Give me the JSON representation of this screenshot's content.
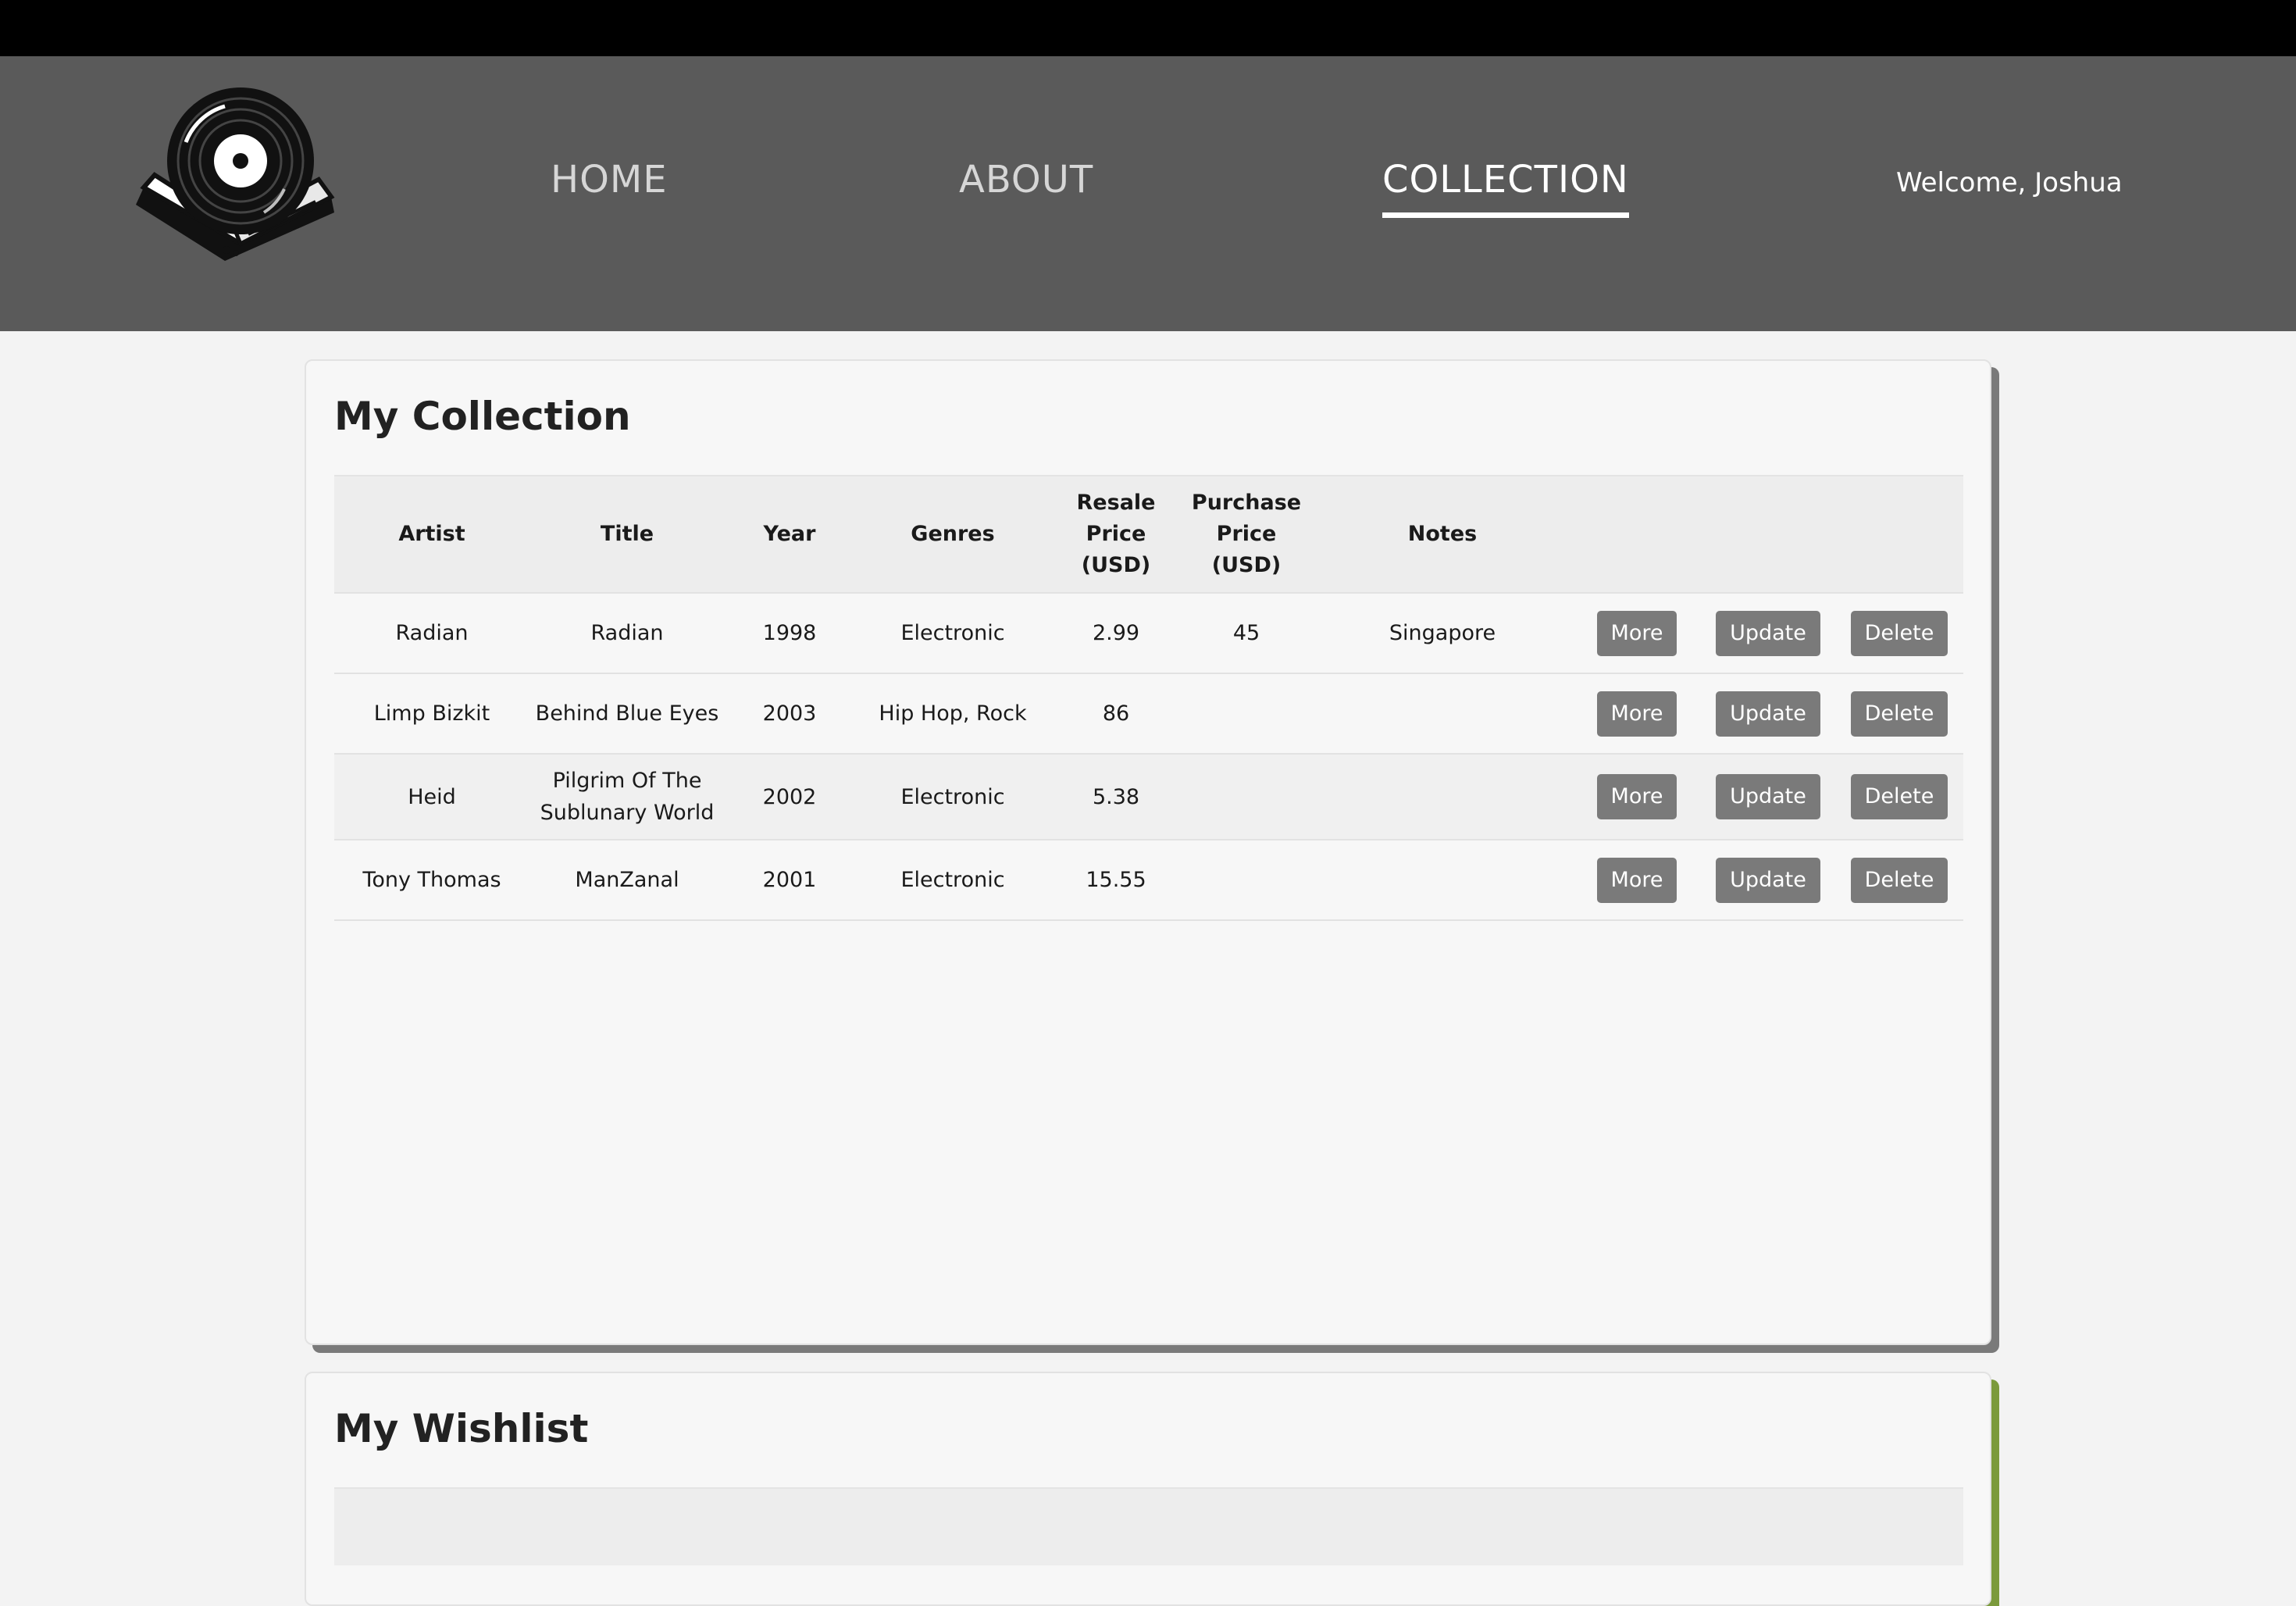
{
  "nav": {
    "logo_alt": "vinyl record logo",
    "items": [
      {
        "label": "HOME",
        "active": false
      },
      {
        "label": "ABOUT",
        "active": false
      },
      {
        "label": "COLLECTION",
        "active": true
      }
    ],
    "welcome": "Welcome, Joshua"
  },
  "collection": {
    "title": "My Collection",
    "headers": {
      "artist": "Artist",
      "title": "Title",
      "year": "Year",
      "genres": "Genres",
      "resale_1": "Resale",
      "resale_2": "Price",
      "resale_3": "(USD)",
      "purchase_1": "Purchase",
      "purchase_2": "Price",
      "purchase_3": "(USD)",
      "notes": "Notes"
    },
    "actions": {
      "more": "More",
      "update": "Update",
      "delete": "Delete"
    },
    "rows": [
      {
        "artist": "Radian",
        "title": "Radian",
        "title_2": "",
        "year": "1998",
        "genres": "Electronic",
        "resale": "2.99",
        "purchase": "45",
        "notes": "Singapore"
      },
      {
        "artist": "Limp Bizkit",
        "title": "Behind Blue Eyes",
        "title_2": "",
        "year": "2003",
        "genres": "Hip Hop, Rock",
        "resale": "86",
        "purchase": "",
        "notes": ""
      },
      {
        "artist": "Heid",
        "title": "Pilgrim Of The",
        "title_2": "Sublunary World",
        "year": "2002",
        "genres": "Electronic",
        "resale": "5.38",
        "purchase": "",
        "notes": ""
      },
      {
        "artist": "Tony Thomas",
        "title": "ManZanal",
        "title_2": "",
        "year": "2001",
        "genres": "Electronic",
        "resale": "15.55",
        "purchase": "",
        "notes": ""
      }
    ]
  },
  "wishlist": {
    "title": "My Wishlist"
  },
  "colors": {
    "header_bg": "#5a5a5a",
    "topbar_bg": "#000000",
    "button_bg": "#7a7a7a",
    "collection_shadow": "#7a7a7a",
    "wishlist_accent": "#7b9a3c"
  }
}
